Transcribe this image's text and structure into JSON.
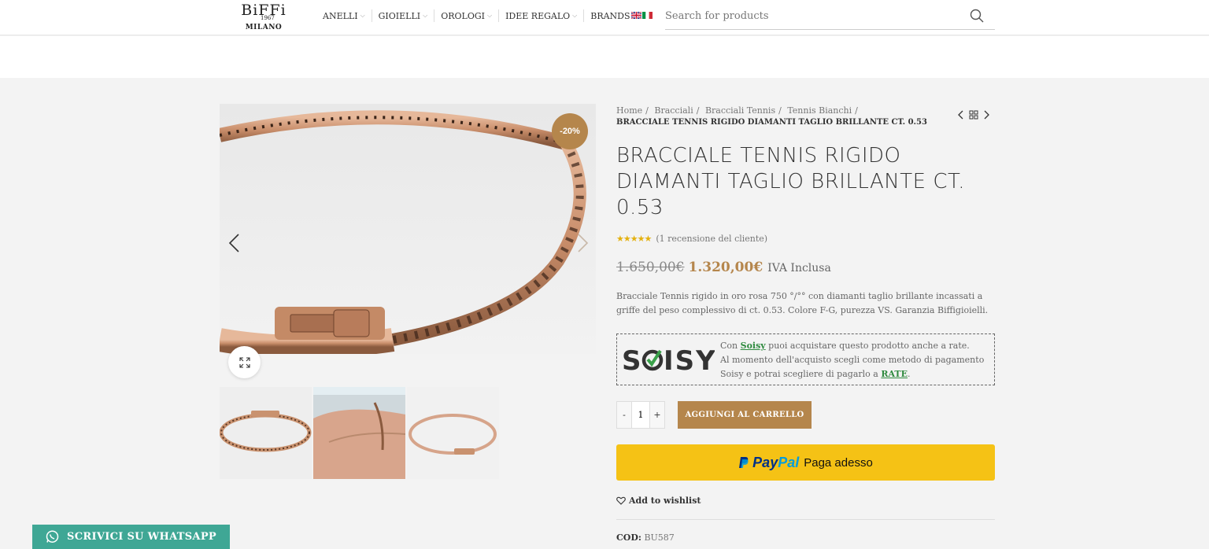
{
  "header": {
    "logo": {
      "brand": "BiFFi",
      "year": "1967",
      "city": "MILANO"
    },
    "nav": [
      {
        "label": "ANELLI"
      },
      {
        "label": "GIOIELLI"
      },
      {
        "label": "OROLOGI"
      },
      {
        "label": "IDEE REGALO"
      },
      {
        "label": "BRANDS"
      }
    ],
    "search_placeholder": "Search for products"
  },
  "product": {
    "badge": "-20%",
    "breadcrumbs": [
      "Home",
      "Bracciali",
      "Bracciali Tennis",
      "Tennis Bianchi"
    ],
    "breadcrumb_current": "BRACCIALE TENNIS RIGIDO DIAMANTI TAGLIO BRILLANTE CT. 0.53",
    "title": "BRACCIALE TENNIS RIGIDO DIAMANTI TAGLIO BRILLANTE CT. 0.53",
    "stars": "★★★★★",
    "rating_text": "(1 recensione del cliente)",
    "price_old": "1.650,00€",
    "price_new": "1.320,00€",
    "price_note": "IVA Inclusa",
    "description": "Bracciale Tennis rigido in oro rosa 750 °/°° con diamanti taglio brillante incassati a griffe del peso complessivo di ct. 0.53. Colore F-G, purezza VS. Garanzia Biffigioielli.",
    "soisy": {
      "logo": "SOISY",
      "pre": "Con",
      "link": "Soisy",
      "line1_rest": "puoi acquistare questo prodotto anche a rate.",
      "line2": "Al momento dell'acquisto scegli come metodo di pagamento",
      "line3_pre": "Soisy e potrai scegliere di pagarlo a",
      "line3_link": "RATE",
      "line3_post": "."
    },
    "quantity": {
      "minus": "-",
      "value": "1",
      "plus": "+"
    },
    "add_to_cart": "AGGIUNGI AL CARRELLO",
    "paypal": {
      "brand_pay": "Pay",
      "brand_pal": "Pal",
      "label": "Paga adesso"
    },
    "wishlist": "Add to wishlist",
    "sku_label": "COD:",
    "sku_value": "BU587"
  },
  "whatsapp": "SCRIVICI SU WHATSAPP",
  "colors": {
    "accent": "#b5864c",
    "paypal": "#f5c215",
    "whatsapp": "#3fa795",
    "soisy_green": "#2f8a3f"
  }
}
